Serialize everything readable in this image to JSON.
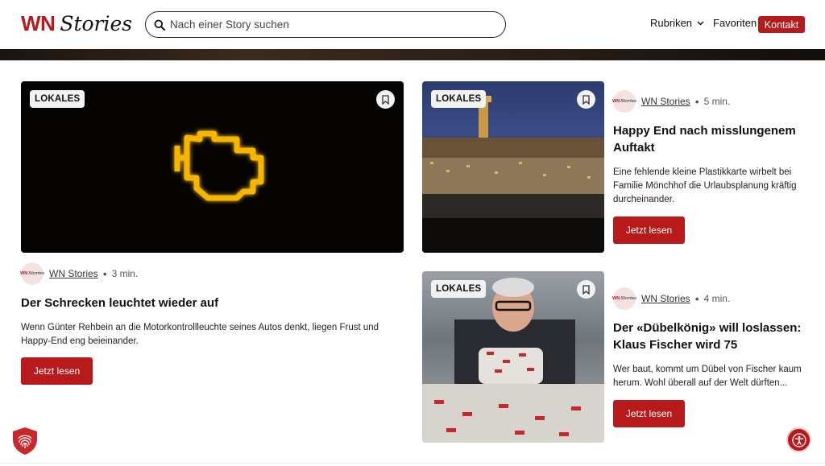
{
  "header": {
    "logo_wn": "WN",
    "logo_stories": "Stories",
    "search_placeholder": "Nach einer Story suchen",
    "nav_rubriken": "Rubriken",
    "nav_favoriten": "Favoriten",
    "kontakt_label": "Kontakt"
  },
  "colors": {
    "accent": "#b8191b",
    "badge_bg": "#f2f2f2"
  },
  "articles": [
    {
      "badge": "LOKALES",
      "source": "WN Stories",
      "read_time": "3 min.",
      "title": "Der Schrecken leuchtet wieder auf",
      "description": "Wenn Günter Rehbein an die Motorkontrollleuchte seines Autos denkt, liegen Frust und Happy-End eng beieinander.",
      "button": "Jetzt lesen"
    },
    {
      "badge": "LOKALES",
      "source": "WN Stories",
      "read_time": "5 min.",
      "title": "Happy End nach misslungenem Auftakt",
      "description": "Eine fehlende kleine Plastikkarte wirbelt bei Familie Mönchhof die Urlaubsplanung kräftig durcheinander.",
      "button": "Jetzt lesen"
    },
    {
      "badge": "LOKALES",
      "source": "WN Stories",
      "read_time": "4 min.",
      "title": "Der «Dübelkönig» will loslassen: Klaus Fischer wird 75",
      "description": "Wer baut, kommt um Dübel von Fischer kaum herum. Wohl überall auf der Welt dürften...",
      "button": "Jetzt lesen"
    }
  ],
  "avatar_text": {
    "wn": "WN",
    "stories": "Stories"
  },
  "icons": [
    "search-icon",
    "chevron-down-icon",
    "bookmark-icon",
    "fingerprint-shield-icon",
    "accessibility-icon"
  ]
}
